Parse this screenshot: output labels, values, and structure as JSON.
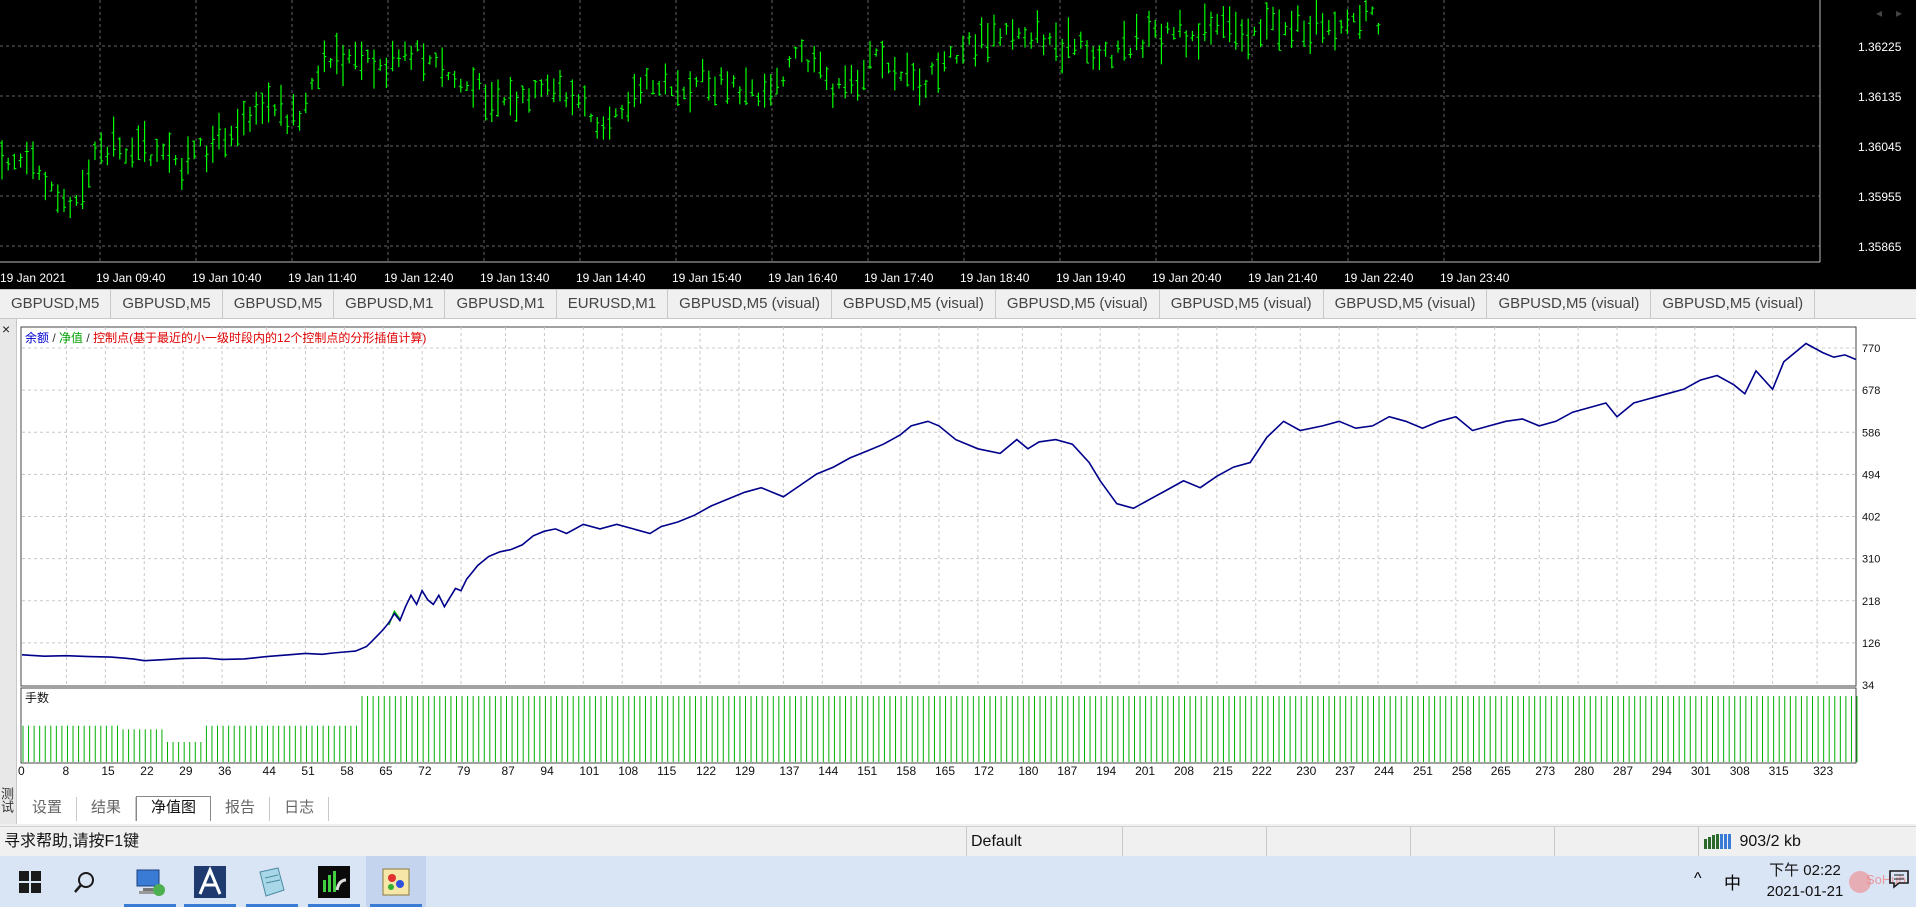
{
  "price_chart": {
    "time_labels": [
      "19 Jan 2021",
      "19 Jan 09:40",
      "19 Jan 10:40",
      "19 Jan 11:40",
      "19 Jan 12:40",
      "19 Jan 13:40",
      "19 Jan 14:40",
      "19 Jan 15:40",
      "19 Jan 16:40",
      "19 Jan 17:40",
      "19 Jan 18:40",
      "19 Jan 19:40",
      "19 Jan 20:40",
      "19 Jan 21:40",
      "19 Jan 22:40",
      "19 Jan 23:40"
    ],
    "price_labels": [
      "1.36225",
      "1.36135",
      "1.36045",
      "1.35955",
      "1.35865"
    ],
    "bar_color": "#00ff00",
    "background": "#000000",
    "grid_color": "#646464"
  },
  "chart_tabs": [
    "GBPUSD,M5",
    "GBPUSD,M5",
    "GBPUSD,M5",
    "GBPUSD,M1",
    "GBPUSD,M1",
    "EURUSD,M1",
    "GBPUSD,M5 (visual)",
    "GBPUSD,M5 (visual)",
    "GBPUSD,M5 (visual)",
    "GBPUSD,M5 (visual)",
    "GBPUSD,M5 (visual)",
    "GBPUSD,M5 (visual)",
    "GBPUSD,M5 (visual)"
  ],
  "tab_scroll": {
    "left": "◂",
    "right": "▸"
  },
  "tester": {
    "close": "×",
    "side_label": "测试",
    "legend": {
      "balance": "余额",
      "sep1": " / ",
      "equity": "净值",
      "sep2": " / ",
      "control": "控制点(基于最近的小一级时段内的12个控制点的分形插值计算)"
    },
    "lots_label": "手数",
    "tabs": [
      "设置",
      "结果",
      "净值图",
      "报告",
      "日志"
    ],
    "active_tab": "净值图"
  },
  "chart_data": {
    "type": "line",
    "ylim": [
      34,
      816
    ],
    "yticks": [
      770,
      678,
      586,
      494,
      402,
      310,
      218,
      126,
      34
    ],
    "xlim": [
      0,
      330
    ],
    "xticks": [
      0,
      8,
      15,
      22,
      29,
      36,
      44,
      51,
      58,
      65,
      72,
      79,
      87,
      94,
      101,
      108,
      115,
      122,
      129,
      137,
      144,
      151,
      158,
      165,
      172,
      180,
      187,
      194,
      201,
      208,
      215,
      222,
      230,
      237,
      244,
      251,
      258,
      265,
      273,
      280,
      287,
      294,
      301,
      308,
      315,
      323
    ],
    "series": [
      {
        "name": "余额",
        "color": "#00008b",
        "x": [
          0,
          4,
          8,
          12,
          16,
          20,
          22,
          25,
          29,
          33,
          36,
          40,
          44,
          48,
          51,
          54,
          56,
          58,
          60,
          62,
          63,
          65,
          66,
          67,
          68,
          69,
          70,
          71,
          72,
          73,
          74,
          75,
          76,
          77,
          78,
          79,
          80,
          81,
          82,
          84,
          86,
          88,
          90,
          92,
          94,
          96,
          98,
          101,
          104,
          107,
          110,
          113,
          115,
          118,
          121,
          124,
          127,
          130,
          133,
          135,
          137,
          140,
          143,
          146,
          149,
          152,
          155,
          158,
          160,
          163,
          165,
          168,
          172,
          176,
          179,
          181,
          183,
          186,
          189,
          192,
          194,
          197,
          200,
          203,
          206,
          209,
          212,
          215,
          218,
          221,
          224,
          227,
          230,
          234,
          237,
          240,
          243,
          246,
          249,
          252,
          255,
          258,
          261,
          264,
          267,
          270,
          273,
          276,
          279,
          282,
          285,
          287,
          290,
          293,
          296,
          299,
          302,
          305,
          308,
          310,
          312,
          315,
          317,
          319,
          321,
          324,
          326,
          328,
          330
        ],
        "y": [
          100,
          97,
          98,
          96,
          95,
          91,
          87,
          89,
          92,
          93,
          90,
          91,
          96,
          100,
          103,
          101,
          104,
          106,
          108,
          118,
          130,
          155,
          170,
          190,
          175,
          205,
          230,
          210,
          240,
          220,
          210,
          230,
          205,
          225,
          245,
          240,
          265,
          280,
          295,
          315,
          325,
          330,
          340,
          360,
          370,
          375,
          365,
          385,
          375,
          385,
          375,
          365,
          380,
          390,
          405,
          425,
          440,
          455,
          465,
          455,
          445,
          470,
          495,
          510,
          530,
          545,
          560,
          580,
          600,
          610,
          600,
          570,
          550,
          540,
          570,
          550,
          565,
          570,
          560,
          520,
          480,
          430,
          420,
          440,
          460,
          480,
          465,
          490,
          510,
          520,
          575,
          610,
          590,
          600,
          610,
          595,
          600,
          620,
          610,
          595,
          610,
          620,
          590,
          600,
          610,
          615,
          600,
          610,
          630,
          640,
          650,
          620,
          650,
          660,
          670,
          680,
          700,
          710,
          690,
          670,
          720,
          680,
          740,
          760,
          780,
          760,
          750,
          755,
          745
        ]
      },
      {
        "name": "净值",
        "color": "#00b000",
        "x": [
          66,
          67,
          68
        ],
        "y": [
          165,
          195,
          178
        ]
      }
    ],
    "lots": {
      "label": "手数",
      "early_level": 0.55,
      "late_level": 1.0,
      "switch_at": 61
    }
  },
  "statusbar": {
    "help": "寻求帮助,请按F1键",
    "profile": "Default",
    "traffic": "903/2 kb"
  },
  "taskbar": {
    "clock_time": "下午 02:22",
    "clock_date": "2021-01-21",
    "input_method": "中",
    "tray_chevron": "^",
    "watermark": "SoHub"
  }
}
